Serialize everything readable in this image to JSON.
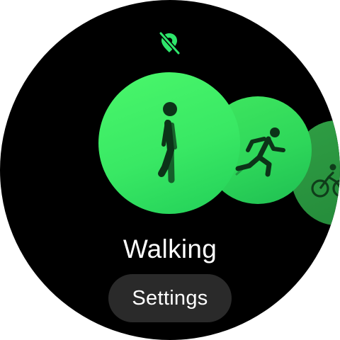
{
  "status": {
    "gps_icon": "gps-off-icon",
    "accent_color": "#2ee66b"
  },
  "activities": [
    {
      "icon": "walking-icon",
      "color": "#3ff06a",
      "selected": true
    },
    {
      "icon": "running-icon",
      "color": "#2ed75a",
      "selected": false
    },
    {
      "icon": "cycling-icon",
      "color": "#2a9a44",
      "selected": false
    }
  ],
  "selected_activity": {
    "label": "Walking"
  },
  "settings": {
    "label": "Settings"
  }
}
